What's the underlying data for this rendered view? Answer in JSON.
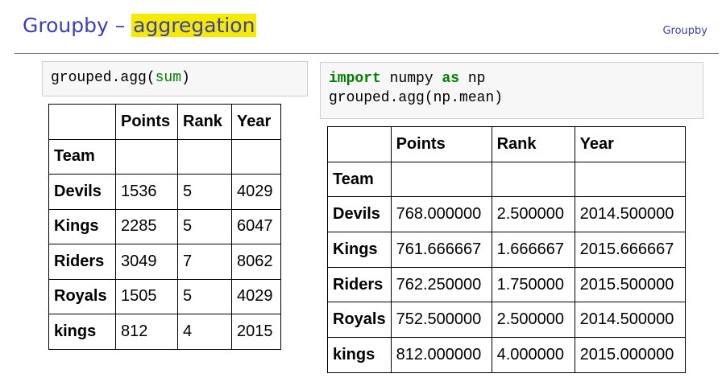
{
  "header": {
    "title_prefix": "Groupby – ",
    "title_highlight": "aggregation",
    "section_tag": "Groupby"
  },
  "left": {
    "code": {
      "fn": "grouped.agg(",
      "arg": "sum",
      "close": ")"
    },
    "table": {
      "columns": [
        "Points",
        "Rank",
        "Year"
      ],
      "index_name": "Team",
      "rows": [
        {
          "team": "Devils",
          "points": "1536",
          "rank": "5",
          "year": "4029"
        },
        {
          "team": "Kings",
          "points": "2285",
          "rank": "5",
          "year": "6047"
        },
        {
          "team": "Riders",
          "points": "3049",
          "rank": "7",
          "year": "8062"
        },
        {
          "team": "Royals",
          "points": "1505",
          "rank": "5",
          "year": "4029"
        },
        {
          "team": "kings",
          "points": "812",
          "rank": "4",
          "year": "2015"
        }
      ]
    }
  },
  "right": {
    "code": {
      "kw_import": "import",
      "module": " numpy ",
      "kw_as": "as",
      "alias": " np",
      "line2": "grouped.agg(np.mean)"
    },
    "table": {
      "columns": [
        "Points",
        "Rank",
        "Year"
      ],
      "index_name": "Team",
      "rows": [
        {
          "team": "Devils",
          "points": "768.000000",
          "rank": "2.500000",
          "year": "2014.500000"
        },
        {
          "team": "Kings",
          "points": "761.666667",
          "rank": "1.666667",
          "year": "2015.666667"
        },
        {
          "team": "Riders",
          "points": "762.250000",
          "rank": "1.750000",
          "year": "2015.500000"
        },
        {
          "team": "Royals",
          "points": "752.500000",
          "rank": "2.500000",
          "year": "2014.500000"
        },
        {
          "team": "kings",
          "points": "812.000000",
          "rank": "4.000000",
          "year": "2015.000000"
        }
      ]
    }
  }
}
